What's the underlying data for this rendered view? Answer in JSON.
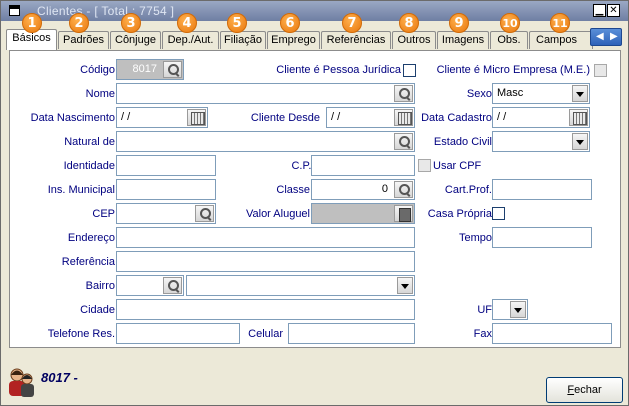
{
  "window": {
    "title": "Clientes - [ Total : 7754 ]",
    "minimize_glyph": "▁",
    "close_glyph": "✕"
  },
  "tabs": [
    {
      "label": "Básicos",
      "badge": "1",
      "active": true
    },
    {
      "label": "Padrões",
      "badge": "2"
    },
    {
      "label": "Cônjuge",
      "badge": "3"
    },
    {
      "label": "Dep./Aut.",
      "badge": "4"
    },
    {
      "label": "Filiação",
      "badge": "5"
    },
    {
      "label": "Emprego",
      "badge": "6"
    },
    {
      "label": "Referências",
      "badge": "7"
    },
    {
      "label": "Outros",
      "badge": "8"
    },
    {
      "label": "Imagens",
      "badge": "9"
    },
    {
      "label": "Obs.",
      "badge": "10"
    },
    {
      "label": "Campos do",
      "badge": "11"
    }
  ],
  "tab_scroll": {
    "left": "◀",
    "right": "▶"
  },
  "form": {
    "codigo_label": "Código",
    "codigo_value": "8017",
    "pessoa_juridica_label": "Cliente é Pessoa Jurídica",
    "micro_empresa_label": "Cliente é Micro Empresa (M.E.)",
    "nome_label": "Nome",
    "nome_value": "",
    "sexo_label": "Sexo",
    "sexo_value": "Masc",
    "data_nascimento_label": "Data Nascimento",
    "data_nascimento_value": " / /",
    "cliente_desde_label": "Cliente Desde",
    "cliente_desde_value": " / /",
    "data_cadastro_label": "Data Cadastro",
    "data_cadastro_value": " / /",
    "natural_label": "Natural de",
    "estado_civil_label": "Estado Civil",
    "identidade_label": "Identidade",
    "cpf_label": "C.P.F.",
    "usar_cpf_label": "Usar CPF",
    "ins_municipal_label": "Ins. Municipal",
    "classe_label": "Classe",
    "classe_value": "0",
    "cart_prof_label": "Cart.Prof.",
    "cep_label": "CEP",
    "valor_aluguel_label": "Valor Aluguel",
    "casa_propria_label": "Casa Própria",
    "endereco_label": "Endereço",
    "tempo_label": "Tempo",
    "referencia_label": "Referência",
    "bairro_label": "Bairro",
    "cidade_label": "Cidade",
    "uf_label": "UF",
    "telefone_label": "Telefone Res.",
    "celular_label": "Celular",
    "fax_label": "Fax"
  },
  "footer": {
    "status_text": "8017 -",
    "close_button": {
      "prefix": "F",
      "rest": "echar"
    }
  },
  "colors": {
    "label_blue": "#000080",
    "label_dark": "#4a0000",
    "badge_orange": "#e8770d",
    "titlebar": "#7f8db0"
  }
}
